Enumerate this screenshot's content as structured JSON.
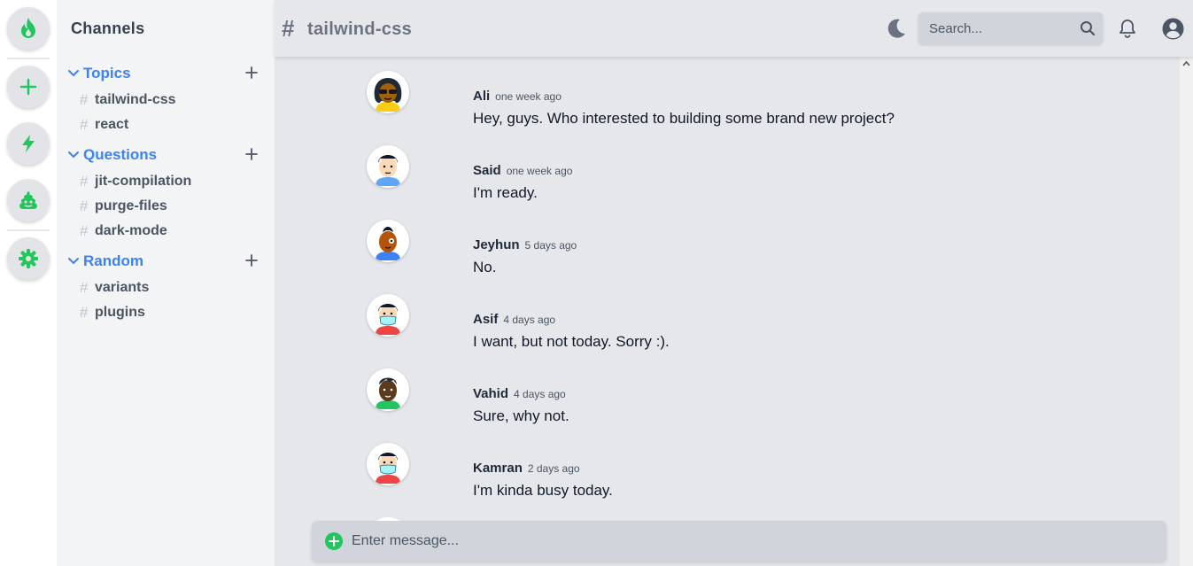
{
  "rail": {
    "items": [
      {
        "icon": "fire-icon",
        "color": "#22c55e"
      },
      {
        "icon": "plus-icon",
        "color": "#22c55e"
      },
      {
        "icon": "bolt-icon",
        "color": "#22c55e"
      },
      {
        "icon": "poo-icon",
        "color": "#22c55e"
      },
      {
        "icon": "gear-icon",
        "color": "#22c55e"
      }
    ]
  },
  "sidebar": {
    "title": "Channels",
    "groups": [
      {
        "label": "Topics",
        "channels": [
          {
            "hash": "#",
            "name": "tailwind-css"
          },
          {
            "hash": "#",
            "name": "react"
          }
        ]
      },
      {
        "label": "Questions",
        "channels": [
          {
            "hash": "#",
            "name": "jit-compilation"
          },
          {
            "hash": "#",
            "name": "purge-files"
          },
          {
            "hash": "#",
            "name": "dark-mode"
          }
        ]
      },
      {
        "label": "Random",
        "channels": [
          {
            "hash": "#",
            "name": "variants"
          },
          {
            "hash": "#",
            "name": "plugins"
          }
        ]
      }
    ]
  },
  "header": {
    "hash": "#",
    "channel_title": "tailwind-css",
    "search_placeholder": "Search..."
  },
  "messages": [
    {
      "author": "Ali",
      "time": "one week ago",
      "text": "Hey, guys. Who interested to building some brand new project?"
    },
    {
      "author": "Said",
      "time": "one week ago",
      "text": "I'm ready."
    },
    {
      "author": "Jeyhun",
      "time": "5 days ago",
      "text": "No."
    },
    {
      "author": "Asif",
      "time": "4 days ago",
      "text": "I want, but not today. Sorry :)."
    },
    {
      "author": "Vahid",
      "time": "4 days ago",
      "text": "Sure, why not."
    },
    {
      "author": "Kamran",
      "time": "2 days ago",
      "text": "I'm kinda busy today."
    }
  ],
  "composer": {
    "placeholder": "Enter message..."
  },
  "colors": {
    "accent": "#3b82f6",
    "brand": "#22c55e"
  }
}
